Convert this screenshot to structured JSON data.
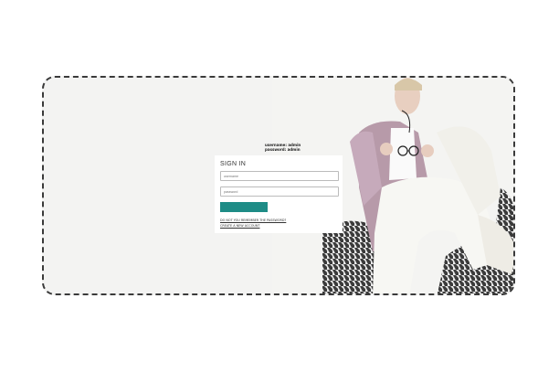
{
  "credentials": {
    "username_line": "username: admin",
    "password_line": "password: admin"
  },
  "login": {
    "title": "SIGN IN",
    "username_placeholder": "username",
    "password_placeholder": "password",
    "submit_label": "",
    "forgot_link": "DO NOT YOU REMEMBER THE PASSWORD?",
    "create_link": "CREATE A NEW ACCOUNT"
  },
  "colors": {
    "accent": "#1e8c86",
    "frame_border": "#3a3a3a",
    "background": "#f3f3f2"
  }
}
